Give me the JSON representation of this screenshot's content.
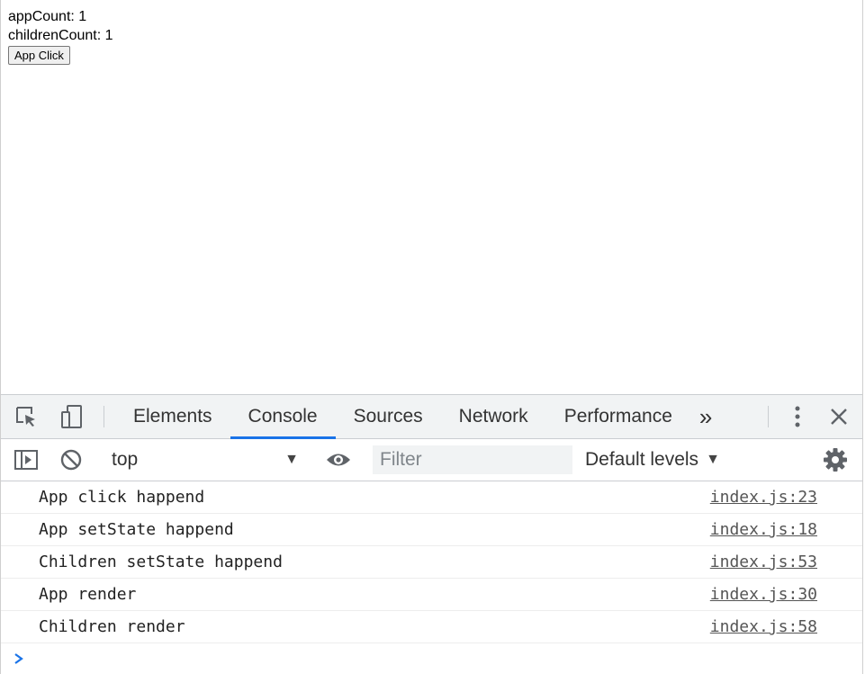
{
  "page": {
    "app_count_label": "appCount",
    "app_count_value": "1",
    "children_count_label": "childrenCount",
    "children_count_value": "1",
    "button_label": "App Click"
  },
  "devtools": {
    "tabs": [
      {
        "label": "Elements"
      },
      {
        "label": "Console",
        "active": true
      },
      {
        "label": "Sources"
      },
      {
        "label": "Network"
      },
      {
        "label": "Performance"
      }
    ],
    "more_tabs_glyph": "»",
    "context": "top",
    "filter_placeholder": "Filter",
    "levels_label": "Default levels",
    "accent_color": "#1a73e8",
    "console": [
      {
        "message": "App click happend",
        "source": "index.js:23"
      },
      {
        "message": "App setState happend",
        "source": "index.js:18"
      },
      {
        "message": "Children setState happend",
        "source": "index.js:53"
      },
      {
        "message": "App render",
        "source": "index.js:30"
      },
      {
        "message": "Children render",
        "source": "index.js:58"
      }
    ],
    "icons": [
      "inspect-element-icon",
      "device-toolbar-icon",
      "more-tabs-icon",
      "kebab-menu-icon",
      "close-icon",
      "sidebar-toggle-icon",
      "clear-console-icon",
      "dropdown-arrow-icon",
      "eye-icon",
      "gear-icon",
      "prompt-chevron-icon"
    ]
  }
}
